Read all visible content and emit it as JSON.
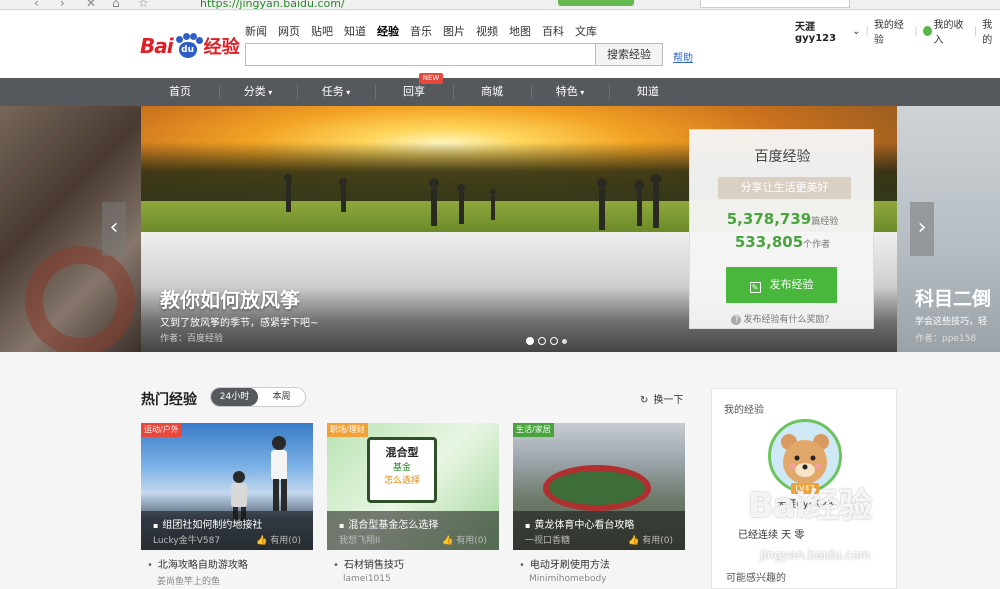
{
  "browser": {
    "url_text": "https://jingyan.baidu.com/"
  },
  "logo": {
    "left": "Bai",
    "paw": "du",
    "right": "经验"
  },
  "top_tabs": [
    {
      "label": "新闻",
      "active": false
    },
    {
      "label": "网页",
      "active": false
    },
    {
      "label": "贴吧",
      "active": false
    },
    {
      "label": "知道",
      "active": false
    },
    {
      "label": "经验",
      "active": true
    },
    {
      "label": "音乐",
      "active": false
    },
    {
      "label": "图片",
      "active": false
    },
    {
      "label": "视频",
      "active": false
    },
    {
      "label": "地图",
      "active": false
    },
    {
      "label": "百科",
      "active": false
    },
    {
      "label": "文库",
      "active": false
    }
  ],
  "search": {
    "value": "",
    "button": "搜索经验",
    "help": "帮助"
  },
  "user": {
    "name": "天涯gyy123",
    "my_exp": "我的经验",
    "income": "我的收入",
    "more": "我的"
  },
  "nav": {
    "items": [
      "首页",
      "分类",
      "任务",
      "回享",
      "商城",
      "特色",
      "知道"
    ],
    "new_badge": "NEW",
    "chevron_items": [
      1,
      2,
      5
    ]
  },
  "hero": {
    "title": "教你如何放风筝",
    "subtitle": "又到了放风筝的季节，感紧学下吧~",
    "author": "作者：百度经验",
    "right_title": "科目二倒",
    "right_sub": "学会这些技巧，轻",
    "right_author": "作者：ppe158"
  },
  "stats": {
    "title": "百度经验",
    "slogan": "分享让生活更美好",
    "count1": "5,378,739",
    "count1_unit": "篇经验",
    "count2": "533,805",
    "count2_unit": "个作者",
    "publish": "发布经验",
    "reward": "发布经验有什么奖励？"
  },
  "hot": {
    "title": "热门经验",
    "seg": [
      "24小时",
      "本周"
    ],
    "refresh": "换一下",
    "cards": [
      {
        "tag": "运动/户外",
        "title": "组团社如何制约地接社",
        "author": "Lucky金牛V587",
        "likes": "有用(0)",
        "below_title": "北海攻略自助游攻略",
        "below_author": "姜尚鱼竿上的鱼"
      },
      {
        "tag": "职场/理财",
        "title": "混合型基金怎么选择",
        "author": "我想飞翔II",
        "likes": "有用(0)",
        "below_title": "石材销售技巧",
        "below_author": "lamei1015"
      },
      {
        "tag": "生活/家居",
        "title": "黄龙体育中心看台攻略",
        "author": "一视口香糖",
        "likes": "有用(0)",
        "below_title": "电动牙刷使用方法",
        "below_author": "Minimihomebody"
      }
    ],
    "card_image_text": {
      "line1": "混合型",
      "line2": "基金",
      "line3": "怎么选择"
    }
  },
  "my": {
    "title": "我的经验",
    "level": "LV47",
    "name": "天涯gyy123",
    "stat": "已经连续  天  零",
    "interest": "可能感兴趣的"
  },
  "watermark": {
    "text": "Bai经验",
    "url": "jingyan.baidu.com"
  },
  "colors": {
    "brand_red": "#de1f26",
    "brand_blue": "#2f5fc6",
    "green": "#49b63c",
    "nav_bg": "#55595e"
  }
}
